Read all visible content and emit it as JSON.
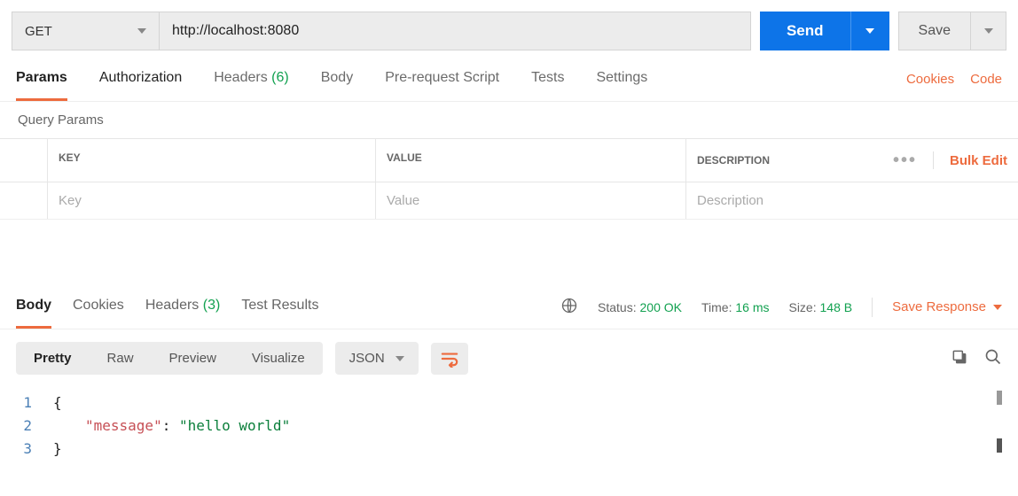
{
  "request": {
    "method": "GET",
    "url": "http://localhost:8080",
    "send_label": "Send",
    "save_label": "Save"
  },
  "req_tabs": {
    "params": "Params",
    "authorization": "Authorization",
    "headers": "Headers",
    "headers_count": "(6)",
    "body": "Body",
    "prerequest": "Pre-request Script",
    "tests": "Tests",
    "settings": "Settings"
  },
  "req_links": {
    "cookies": "Cookies",
    "code": "Code"
  },
  "query_params_title": "Query Params",
  "params_table": {
    "header_key": "KEY",
    "header_value": "VALUE",
    "header_desc": "DESCRIPTION",
    "bulk_edit": "Bulk Edit",
    "placeholder_key": "Key",
    "placeholder_value": "Value",
    "placeholder_desc": "Description"
  },
  "resp_tabs": {
    "body": "Body",
    "cookies": "Cookies",
    "headers": "Headers",
    "headers_count": "(3)",
    "test_results": "Test Results"
  },
  "resp_status": {
    "status_label": "Status:",
    "status_value": "200 OK",
    "time_label": "Time:",
    "time_value": "16 ms",
    "size_label": "Size:",
    "size_value": "148 B"
  },
  "save_response": "Save Response",
  "body_view": {
    "pretty": "Pretty",
    "raw": "Raw",
    "preview": "Preview",
    "visualize": "Visualize",
    "format": "JSON"
  },
  "code": {
    "line1_num": "1",
    "line1_text": "{",
    "line2_num": "2",
    "line2_key": "\"message\"",
    "line2_colon": ": ",
    "line2_val": "\"hello world\"",
    "line3_num": "3",
    "line3_text": "}"
  }
}
